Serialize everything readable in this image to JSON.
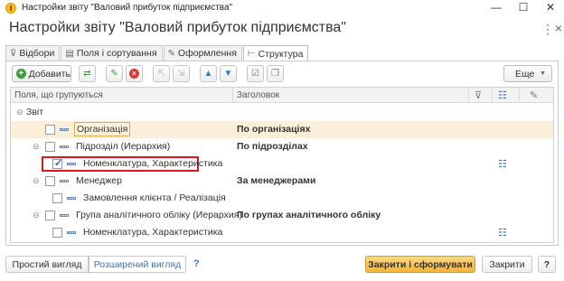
{
  "window": {
    "title": "Настройки звіту \"Валовий прибуток підприємства\"",
    "minimize_glyph": "—",
    "maximize_glyph": "☐",
    "close_glyph": "✕"
  },
  "form": {
    "title": "Настройки звіту \"Валовий прибуток підприємства\"",
    "more_glyph": "⋮",
    "close_glyph": "×"
  },
  "tabs": [
    {
      "label": "Відбори",
      "icon": "filter-icon"
    },
    {
      "label": "Поля і сортування",
      "icon": "fields-icon"
    },
    {
      "label": "Оформлення",
      "icon": "brush-icon"
    },
    {
      "label": "Структура",
      "icon": "structure-icon",
      "active": true
    }
  ],
  "toolbar": {
    "add_label": "Добавить",
    "more_label": "Еще"
  },
  "grid": {
    "col_fields": "Поля, що групуються",
    "col_header": "Заголовок",
    "root_label": "Звіт",
    "rows": [
      {
        "label": "Організація",
        "header": "По організаціях",
        "checked": false
      },
      {
        "label": "Підрозділ (Иерархия)",
        "header": "По підрозділах",
        "checked": false
      },
      {
        "label": "Номенклатура, Характеристика",
        "header": "",
        "checked": true
      },
      {
        "label": "Менеджер",
        "header": "За менеджерами",
        "checked": false
      },
      {
        "label": "Замовлення клієнта / Реалізація",
        "header": "",
        "checked": false
      },
      {
        "label": "Група аналітичного обліку (Иерархия)",
        "header": "По групах аналітичного обліку",
        "checked": false
      },
      {
        "label": "Номенклатура, Характеристика",
        "header": "",
        "checked": false
      }
    ]
  },
  "footer": {
    "simple_view": "Простий вигляд",
    "extended_view": "Розширений вигляд",
    "help1": "?",
    "close_generate": "Закрити і сформувати",
    "close": "Закрити",
    "help2": "?"
  },
  "colors": {
    "highlight_row": "#fbefd9",
    "annotation_red": "#e0161e",
    "primary_button": "#f2b43d",
    "link_blue": "#3a73c5"
  }
}
